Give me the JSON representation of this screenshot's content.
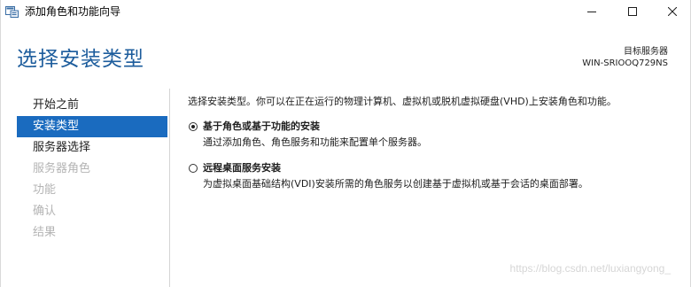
{
  "window": {
    "title": "添加角色和功能向导"
  },
  "header": {
    "page_title": "选择安装类型",
    "target_label": "目标服务器",
    "target_value": "WIN-SRIOOQ729NS"
  },
  "nav": {
    "items": [
      {
        "label": "开始之前",
        "state": "normal"
      },
      {
        "label": "安装类型",
        "state": "active"
      },
      {
        "label": "服务器选择",
        "state": "normal"
      },
      {
        "label": "服务器角色",
        "state": "disabled"
      },
      {
        "label": "功能",
        "state": "disabled"
      },
      {
        "label": "确认",
        "state": "disabled"
      },
      {
        "label": "结果",
        "state": "disabled"
      }
    ]
  },
  "main": {
    "intro": "选择安装类型。你可以在正在运行的物理计算机、虚拟机或脱机虚拟硬盘(VHD)上安装角色和功能。",
    "options": [
      {
        "label": "基于角色或基于功能的安装",
        "description": "通过添加角色、角色服务和功能来配置单个服务器。",
        "checked": true
      },
      {
        "label": "远程桌面服务安装",
        "description": "为虚拟桌面基础结构(VDI)安装所需的角色服务以创建基于虚拟机或基于会话的桌面部署。",
        "checked": false
      }
    ]
  },
  "watermark": "https://blog.csdn.net/luxiangyong_",
  "colors": {
    "accent": "#1a6bbf",
    "title_blue": "#1c5c9c",
    "disabled_text": "#b4b4b4"
  }
}
